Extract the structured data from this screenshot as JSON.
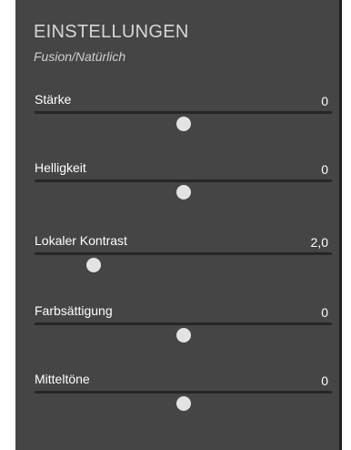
{
  "panel": {
    "title": "EINSTELLUNGEN",
    "subtitle": "Fusion/Natürlich"
  },
  "sliders": [
    {
      "label": "Stärke",
      "value": "0",
      "position": 0.5
    },
    {
      "label": "Helligkeit",
      "value": "0",
      "position": 0.5
    },
    {
      "label": "Lokaler Kontrast",
      "value": "2,0",
      "position": 0.2
    },
    {
      "label": "Farbsättigung",
      "value": "0",
      "position": 0.5
    },
    {
      "label": "Mitteltöne",
      "value": "0",
      "position": 0.5
    }
  ]
}
